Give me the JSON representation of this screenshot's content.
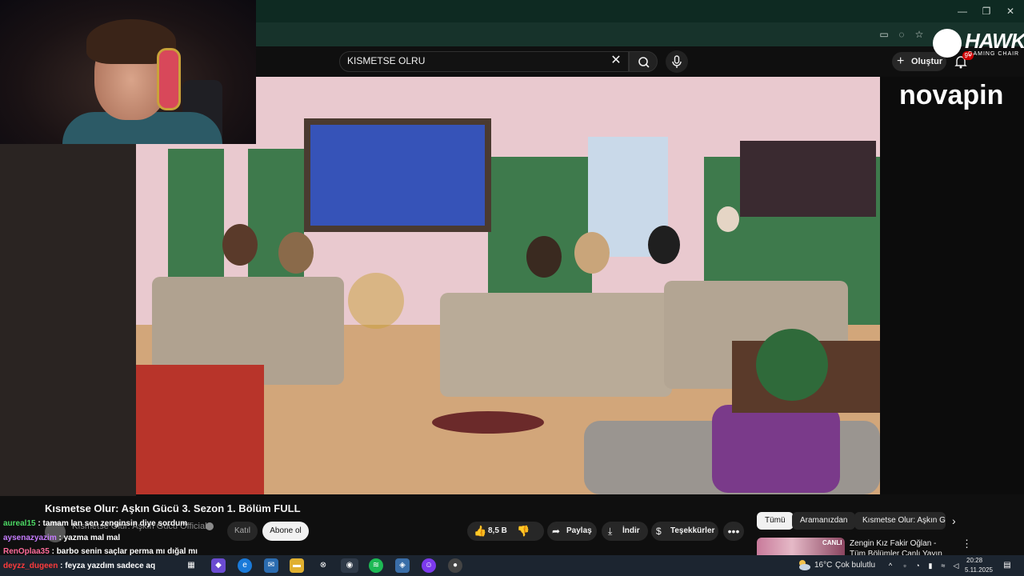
{
  "browser": {
    "window_controls": [
      "—",
      "❐",
      "✕"
    ]
  },
  "youtube": {
    "search": {
      "value": "KISMETSE OLRU",
      "clear": "✕"
    },
    "create_label": "Oluştur",
    "notification_count": "9+"
  },
  "video": {
    "title": "Kısmetse Olur: Aşkın Gücü 3. Sezon 1. Bölüm FULL",
    "channel": "Kısmetse Olur: Aşkın Gücü Official",
    "join_label": "Katıl",
    "subscribe_label": "Abone ol",
    "likes": "8,5 B",
    "share_label": "Paylaş",
    "download_label": "İndir",
    "thanks_label": "Teşekkürler",
    "more": "•••"
  },
  "overlay": {
    "sponsor": "novapin",
    "hawk": "HAWK",
    "hawk_sub": "GAMING CHAIR"
  },
  "chips": {
    "all": "Tümü",
    "search": "Aramanızdan",
    "related": "Kısmetse Olur: Aşkın Gücü",
    "next": "›"
  },
  "recommendation": {
    "live_badge": "CANLI",
    "title": "Zengin Kız Fakir Oğlan - Tüm Bölümler Canlı Yayın",
    "more": "⋮"
  },
  "chat": [
    {
      "user": "aureal15",
      "user_color": "#4cd964",
      "message": ": tamam lan sen zenginsin diye sordum"
    },
    {
      "user": "aysenazyazim",
      "user_color": "#c77dff",
      "message": ": yazma mal mal"
    },
    {
      "user": "RenOplaa35",
      "user_color": "#ff6b9a",
      "message": ": barbo senin saçlar perma mı dığal mı"
    },
    {
      "user": "deyzz_dugeen",
      "user_color": "#ff3b3b",
      "message": ": feyza yazdım sadece aq"
    }
  ],
  "taskbar": {
    "temperature": "16°C",
    "weather": "Çok bulutlu",
    "time": "20:28",
    "date": "5.11.2025"
  }
}
